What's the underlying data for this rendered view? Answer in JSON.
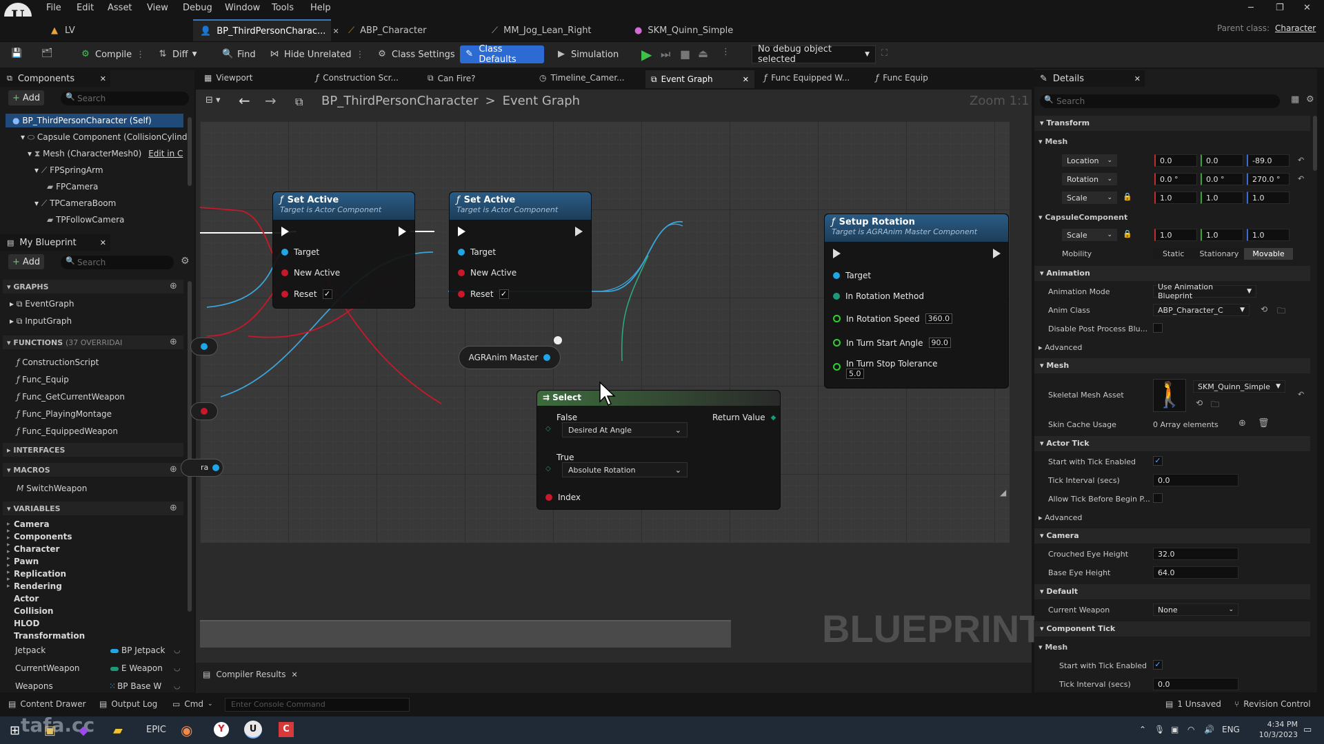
{
  "menu": [
    "File",
    "Edit",
    "Asset",
    "View",
    "Debug",
    "Window",
    "Tools",
    "Help"
  ],
  "doc_tabs": [
    "LV",
    "BP_ThirdPersonCharac...",
    "ABP_Character",
    "MM_Jog_Lean_Right",
    "SKM_Quinn_Simple"
  ],
  "parent_class_label": "Parent class:",
  "parent_class_value": "Character",
  "toolbar": {
    "compile": "Compile",
    "diff": "Diff",
    "find": "Find",
    "hide_unrelated": "Hide Unrelated",
    "class_settings": "Class Settings",
    "class_defaults": "Class Defaults",
    "simulation": "Simulation",
    "debug_object": "No debug object selected"
  },
  "components_panel": {
    "title": "Components",
    "add": "Add",
    "search_placeholder": "Search",
    "tree": [
      "BP_ThirdPersonCharacter (Self)",
      "Capsule Component (CollisionCylind",
      "Mesh (CharacterMesh0)",
      "FPSpringArm",
      "FPCamera",
      "TPCameraBoom",
      "TPFollowCamera"
    ],
    "edit_in": "Edit in C"
  },
  "my_blueprint": {
    "title": "My Blueprint",
    "add": "Add",
    "search_placeholder": "Search",
    "graphs_title": "GRAPHS",
    "graphs": [
      "EventGraph",
      "InputGraph"
    ],
    "functions_title": "FUNCTIONS",
    "functions_overrides": "(37 OVERRIDAI",
    "functions": [
      "ConstructionScript",
      "Func_Equip",
      "Func_GetCurrentWeapon",
      "Func_PlayingMontage",
      "Func_EquippedWeapon"
    ],
    "interfaces_title": "INTERFACES",
    "macros_title": "MACROS",
    "macros": [
      "SwitchWeapon"
    ],
    "variables_title": "VARIABLES",
    "var_categories": [
      "Camera",
      "Components",
      "Character",
      "Pawn",
      "Replication",
      "Rendering",
      "Actor",
      "Collision",
      "HLOD",
      "Transformation"
    ],
    "variables": [
      {
        "name": "Jetpack",
        "type": "BP Jetpack",
        "color": "#1ea6e8"
      },
      {
        "name": "CurrentWeapon",
        "type": "E Weapon",
        "color": "#1a9a7a"
      },
      {
        "name": "Weapons",
        "type": "BP Base W",
        "color": "#1ea6e8"
      }
    ]
  },
  "graph_tabs": [
    "Viewport",
    "Construction Scr...",
    "Can Fire?",
    "Timeline_Camer...",
    "Event Graph",
    "Func Equipped W...",
    "Func Equip"
  ],
  "breadcrumb": {
    "blueprint": "BP_ThirdPersonCharacter",
    "graph": "Event Graph"
  },
  "zoom": "Zoom 1:1",
  "watermark": "BLUEPRINT",
  "nodes": {
    "set_active_1": {
      "title": "Set Active",
      "sub": "Target is Actor Component",
      "pins": [
        "Target",
        "New Active",
        "Reset"
      ]
    },
    "set_active_2": {
      "title": "Set Active",
      "sub": "Target is Actor Component",
      "pins": [
        "Target",
        "New Active",
        "Reset"
      ]
    },
    "setup_rotation": {
      "title": "Setup Rotation",
      "sub": "Target is AGRAnim Master Component",
      "pins": [
        "Target",
        "In Rotation Method",
        "In Rotation Speed",
        "In Turn Start Angle",
        "In Turn Stop Tolerance"
      ],
      "values": {
        "speed": "360.0",
        "angle": "90.0",
        "tolerance": "5.0"
      }
    },
    "agr_master": {
      "title": "AGRAnim Master"
    },
    "select": {
      "title": "Select",
      "false_label": "False",
      "false_value": "Desired At Angle",
      "true_label": "True",
      "true_value": "Absolute Rotation",
      "index": "Index",
      "return": "Return Value"
    },
    "partial_var": "ra"
  },
  "compiler_tab": "Compiler Results",
  "details": {
    "title": "Details",
    "search_placeholder": "Search",
    "transform": "Transform",
    "mesh": "Mesh",
    "location_label": "Location",
    "location": [
      "0.0",
      "0.0",
      "-89.0"
    ],
    "rotation_label": "Rotation",
    "rotation": [
      "0.0 °",
      "0.0 °",
      "270.0 °"
    ],
    "scale_label": "Scale",
    "scale": [
      "1.0",
      "1.0",
      "1.0"
    ],
    "capsule": "CapsuleComponent",
    "capsule_scale": [
      "1.0",
      "1.0",
      "1.0"
    ],
    "mobility_label": "Mobility",
    "mobility": [
      "Static",
      "Stationary",
      "Movable"
    ],
    "animation": "Animation",
    "anim_mode_label": "Animation Mode",
    "anim_mode": "Use Animation Blueprint",
    "anim_class_label": "Anim Class",
    "anim_class": "ABP_Character_C",
    "disable_post": "Disable Post Process Blu...",
    "advanced": "Advanced",
    "mesh2": "Mesh",
    "skeletal_label": "Skeletal Mesh Asset",
    "skeletal": "SKM_Quinn_Simple",
    "skin_cache_label": "Skin Cache Usage",
    "skin_cache": "0 Array elements",
    "actor_tick": "Actor Tick",
    "start_tick_label": "Start with Tick Enabled",
    "tick_interval_label": "Tick Interval (secs)",
    "tick_interval": "0.0",
    "allow_tick": "Allow Tick Before Begin P...",
    "advanced2": "Advanced",
    "camera": "Camera",
    "crouched_label": "Crouched Eye Height",
    "crouched": "32.0",
    "base_eye_label": "Base Eye Height",
    "base_eye": "64.0",
    "default": "Default",
    "current_weapon_label": "Current Weapon",
    "current_weapon": "None",
    "component_tick": "Component Tick",
    "mesh3": "Mesh",
    "start_tick2_label": "Start with Tick Enabled",
    "tick_interval2_label": "Tick Interval (secs)",
    "tick_interval2": "0.0"
  },
  "statusbar": {
    "content_drawer": "Content Drawer",
    "output_log": "Output Log",
    "cmd": "Cmd",
    "console_placeholder": "Enter Console Command",
    "unsaved": "1 Unsaved",
    "revision": "Revision Control"
  },
  "taskbar": {
    "lang": "ENG",
    "time": "4:34 PM",
    "date": "10/3/2023",
    "brand": "tafa.cc"
  }
}
